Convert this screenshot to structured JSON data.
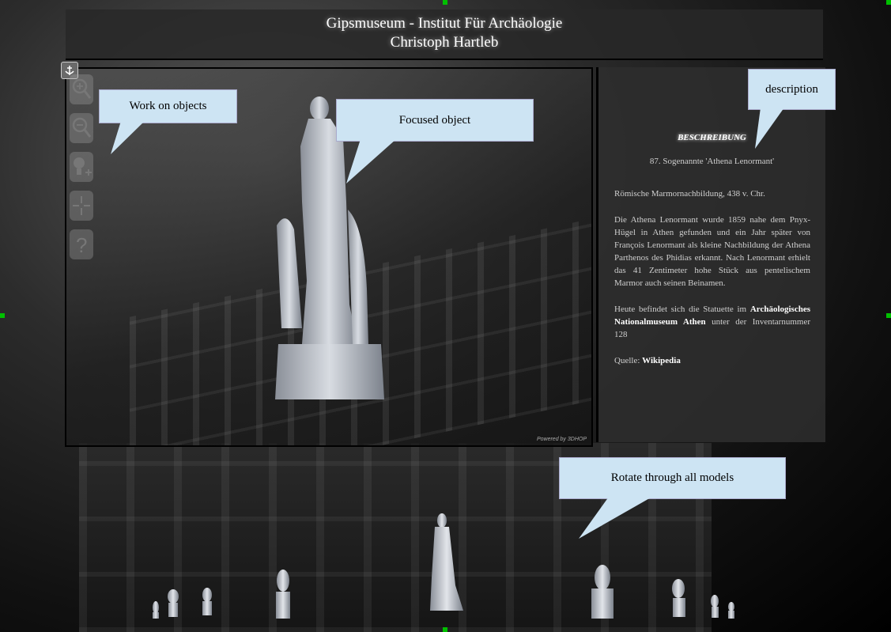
{
  "header": {
    "title": "Gipsmuseum - Institut Für Archäologie",
    "author": "Christoph Hartleb"
  },
  "viewer": {
    "powered_by": "Powered by 3DHOP",
    "tools": [
      "zoom-in-icon",
      "zoom-out-icon",
      "light-icon",
      "center-icon",
      "help-icon"
    ]
  },
  "description": {
    "heading": "BESCHREIBUNG",
    "subtitle": "87. Sogenannte 'Athena Lenormant'",
    "p1": "Römische Marmornachbildung, 438 v. Chr.",
    "p2": "Die Athena Lenormant wurde 1859 nahe dem Pnyx-Hügel in Athen gefunden und ein Jahr später von François Lenormant als kleine Nachbildung der Athena Parthenos des Phidias erkannt. Nach Lenormant erhielt das 41 Zentimeter hohe Stück aus pentelischem Marmor auch seinen Beinamen.",
    "p3_pre": "Heute befindet sich die Statuette im ",
    "p3_link": "Archäologisches Nationalmuseum Athen",
    "p3_post": " unter der Inventarnummer 128",
    "source_label": "Quelle: ",
    "source_link": "Wikipedia"
  },
  "callouts": {
    "work": "Work on objects",
    "focused": "Focused object",
    "description": "description",
    "rotate": "Rotate through all models"
  },
  "colors": {
    "callout_bg": "#cde4f3",
    "handle": "#00c000"
  }
}
